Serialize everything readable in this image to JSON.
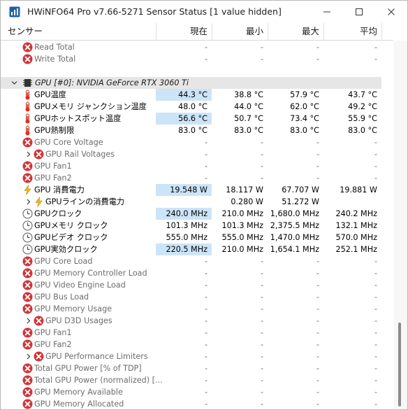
{
  "window": {
    "title": "HWiNFO64 Pro v7.66-5271 Sensor Status [1 value hidden]"
  },
  "columns": {
    "sensor": "センサー",
    "current": "現在",
    "min": "最小",
    "max": "最大",
    "avg": "平均"
  },
  "rows": [
    {
      "type": "sensor",
      "icon": "error",
      "indent": 48,
      "label": "Read Total",
      "cur": "-",
      "min": "-",
      "max": "-",
      "avg": "-",
      "dim": true
    },
    {
      "type": "sensor",
      "icon": "error",
      "indent": 48,
      "label": "Write Total",
      "cur": "-",
      "min": "-",
      "max": "-",
      "avg": "-",
      "dim": true
    },
    {
      "type": "blank"
    },
    {
      "type": "group",
      "label": "GPU [#0]: NVIDIA GeForce RTX 3060 Ti"
    },
    {
      "type": "sensor",
      "icon": "thermo",
      "indent": 48,
      "label": "GPU温度",
      "cur": "44.3 °C",
      "min": "38.8 °C",
      "max": "57.9 °C",
      "avg": "43.7 °C",
      "hl": true
    },
    {
      "type": "sensor",
      "icon": "thermo",
      "indent": 48,
      "label": "GPUメモリ ジャンクション温度",
      "cur": "48.0 °C",
      "min": "44.0 °C",
      "max": "62.0 °C",
      "avg": "49.2 °C"
    },
    {
      "type": "sensor",
      "icon": "thermo",
      "indent": 48,
      "label": "GPUホットスポット温度",
      "cur": "56.6 °C",
      "min": "50.7 °C",
      "max": "73.4 °C",
      "avg": "55.9 °C",
      "hl": true
    },
    {
      "type": "sensor",
      "icon": "thermo",
      "indent": 48,
      "label": "GPU熱制限",
      "cur": "83.0 °C",
      "min": "83.0 °C",
      "max": "83.0 °C",
      "avg": "83.0 °C"
    },
    {
      "type": "sensor",
      "icon": "error",
      "indent": 48,
      "label": "GPU Core Voltage",
      "cur": "-",
      "min": "-",
      "max": "-",
      "avg": "-",
      "dim": true
    },
    {
      "type": "sensor",
      "icon": "error",
      "indent": 64,
      "expander": true,
      "label": "GPU Rail Voltages",
      "cur": "-",
      "min": "-",
      "max": "-",
      "avg": "-",
      "dim": true
    },
    {
      "type": "sensor",
      "icon": "error",
      "indent": 48,
      "label": "GPU Fan1",
      "cur": "-",
      "min": "-",
      "max": "-",
      "avg": "-",
      "dim": true
    },
    {
      "type": "sensor",
      "icon": "error",
      "indent": 48,
      "label": "GPU Fan2",
      "cur": "-",
      "min": "-",
      "max": "-",
      "avg": "-",
      "dim": true
    },
    {
      "type": "sensor",
      "icon": "bolt",
      "indent": 48,
      "label": "GPU 消費電力",
      "cur": "19.548 W",
      "min": "18.117 W",
      "max": "67.707 W",
      "avg": "19.881 W",
      "hl": true
    },
    {
      "type": "sensor",
      "icon": "bolt",
      "indent": 64,
      "expander": true,
      "label": "GPUラインの消費電力",
      "cur": "",
      "min": "0.280 W",
      "max": "51.272 W",
      "avg": ""
    },
    {
      "type": "sensor",
      "icon": "clock",
      "indent": 48,
      "label": "GPUクロック",
      "cur": "240.0 MHz",
      "min": "210.0 MHz",
      "max": "1,680.0 MHz",
      "avg": "240.2 MHz",
      "hl": true
    },
    {
      "type": "sensor",
      "icon": "clock",
      "indent": 48,
      "label": "GPUメモリ クロック",
      "cur": "101.3 MHz",
      "min": "101.3 MHz",
      "max": "2,375.5 MHz",
      "avg": "132.1 MHz"
    },
    {
      "type": "sensor",
      "icon": "clock",
      "indent": 48,
      "label": "GPUビデオ クロック",
      "cur": "555.0 MHz",
      "min": "555.0 MHz",
      "max": "1,470.0 MHz",
      "avg": "570.0 MHz"
    },
    {
      "type": "sensor",
      "icon": "clock",
      "indent": 48,
      "label": "GPU実効クロック",
      "cur": "220.5 MHz",
      "min": "210.0 MHz",
      "max": "1,654.1 MHz",
      "avg": "252.1 MHz",
      "hl": true
    },
    {
      "type": "sensor",
      "icon": "error",
      "indent": 48,
      "label": "GPU Core Load",
      "cur": "-",
      "min": "-",
      "max": "-",
      "avg": "-",
      "dim": true
    },
    {
      "type": "sensor",
      "icon": "error",
      "indent": 48,
      "label": "GPU Memory Controller Load",
      "cur": "-",
      "min": "-",
      "max": "-",
      "avg": "-",
      "dim": true
    },
    {
      "type": "sensor",
      "icon": "error",
      "indent": 48,
      "label": "GPU Video Engine Load",
      "cur": "-",
      "min": "-",
      "max": "-",
      "avg": "-",
      "dim": true
    },
    {
      "type": "sensor",
      "icon": "error",
      "indent": 48,
      "label": "GPU Bus Load",
      "cur": "-",
      "min": "-",
      "max": "-",
      "avg": "-",
      "dim": true
    },
    {
      "type": "sensor",
      "icon": "error",
      "indent": 48,
      "label": "GPU Memory Usage",
      "cur": "-",
      "min": "-",
      "max": "-",
      "avg": "-",
      "dim": true
    },
    {
      "type": "sensor",
      "icon": "error",
      "indent": 64,
      "expander": true,
      "label": "GPU D3D Usages",
      "cur": "-",
      "min": "-",
      "max": "-",
      "avg": "-",
      "dim": true
    },
    {
      "type": "sensor",
      "icon": "error",
      "indent": 48,
      "label": "GPU Fan1",
      "cur": "-",
      "min": "-",
      "max": "-",
      "avg": "-",
      "dim": true
    },
    {
      "type": "sensor",
      "icon": "error",
      "indent": 48,
      "label": "GPU Fan2",
      "cur": "-",
      "min": "-",
      "max": "-",
      "avg": "-",
      "dim": true
    },
    {
      "type": "sensor",
      "icon": "error",
      "indent": 64,
      "expander": true,
      "label": "GPU Performance Limiters",
      "cur": "-",
      "min": "-",
      "max": "-",
      "avg": "-",
      "dim": true
    },
    {
      "type": "sensor",
      "icon": "error",
      "indent": 48,
      "label": "Total GPU Power [% of TDP]",
      "cur": "-",
      "min": "-",
      "max": "-",
      "avg": "-",
      "dim": true
    },
    {
      "type": "sensor",
      "icon": "error",
      "indent": 48,
      "label": "Total GPU Power (normalized) [...",
      "cur": "-",
      "min": "-",
      "max": "-",
      "avg": "-",
      "dim": true
    },
    {
      "type": "sensor",
      "icon": "error",
      "indent": 48,
      "label": "GPU Memory Available",
      "cur": "-",
      "min": "-",
      "max": "-",
      "avg": "-",
      "dim": true
    },
    {
      "type": "sensor",
      "icon": "error",
      "indent": 48,
      "label": "GPU Memory Allocated",
      "cur": "-",
      "min": "-",
      "max": "-",
      "avg": "-",
      "dim": true
    }
  ]
}
